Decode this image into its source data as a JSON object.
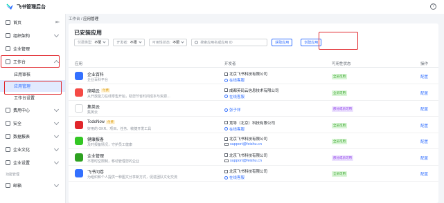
{
  "brand": {
    "name": "飞书管理后台",
    "help": "?"
  },
  "sidebar": {
    "collapse": "⇤",
    "items": [
      {
        "label": "首页"
      },
      {
        "label": "组织架构"
      },
      {
        "label": "企业管理"
      },
      {
        "label": "工作台"
      }
    ],
    "sub_items": [
      {
        "label": "应用审核"
      },
      {
        "label": "应用管理"
      },
      {
        "label": "工作台设置"
      }
    ],
    "items2": [
      {
        "label": "费用中心"
      },
      {
        "label": "安全"
      },
      {
        "label": "数据报表"
      },
      {
        "label": "企业文化"
      },
      {
        "label": "企业设置"
      }
    ],
    "group": "功能管理",
    "items3": [
      {
        "label": "邮箱"
      }
    ]
  },
  "breadcrumb": {
    "parent": "工作台",
    "sep": "/",
    "current": "应用管理"
  },
  "panel": {
    "title": "已安装应用",
    "filters": [
      {
        "label": "付费类型:",
        "value": "不限"
      },
      {
        "label": "开发者:",
        "value": "不限"
      },
      {
        "label": "可用性状态:",
        "value": "不限"
      }
    ],
    "search_placeholder": "搜索应用名或应用 ID",
    "get_app_btn": "获取应用",
    "create_app_btn": "创建应用",
    "columns": {
      "app": "应用",
      "developer": "开发者",
      "status": "可用性状态",
      "op": "操作"
    }
  },
  "apps": [
    {
      "name": "企业百科",
      "tag": "",
      "desc": "企业百科平台",
      "dev": "北京飞书科技有限公司",
      "contact": "在线客服",
      "status": "全员可用",
      "status_type": "all",
      "op": "配置",
      "color": "#3370ff"
    },
    {
      "name": "席喵云",
      "tag": "付费",
      "desc": "从开放能力在线零售开始，助您节省时间成本与资源…",
      "dev": "成都英码云信息技术有限公司",
      "contact": "在线客服",
      "status": "全员可用",
      "status_type": "all",
      "op": "配置",
      "color": "#f54a45"
    },
    {
      "name": "集英云",
      "tag": "",
      "desc": "集英云",
      "dev": "",
      "contact": "张子祥",
      "status": "部分成员可用",
      "status_type": "part",
      "op": "配置",
      "color": "#ffffff"
    },
    {
      "name": "TodoNow",
      "tag": "付费",
      "desc": "好用的 OKR、项目、任务、敏捷开发工具",
      "dev": "竞导（北京）科技有限公司",
      "contact": "在线客服",
      "status": "全员可用",
      "status_type": "all",
      "op": "配置",
      "color": "#e0262b"
    },
    {
      "name": "健康报备",
      "tag": "",
      "desc": "及时报备情况，守护员工健康",
      "dev": "北京飞书科技有限公司",
      "contact": "support@feishu.cn",
      "status": "全员可用",
      "status_type": "all",
      "op": "配置",
      "color": "#34c724"
    },
    {
      "name": "企业管理",
      "tag": "",
      "desc": "不限时空限制，移动管理您的企业",
      "dev": "北京飞书科技有限公司",
      "contact": "support@feishu.cn",
      "status": "部分成员可用",
      "status_type": "part",
      "op": "配置",
      "color": "#2ea121"
    },
    {
      "name": "飞书问卷",
      "tag": "",
      "desc": "为组织和个人提供一种图文分享新方式，促进团队文化交流",
      "dev": "北京飞书科技有限公司",
      "contact": "在线客服",
      "status": "全员可用",
      "status_type": "all",
      "op": "配置",
      "color": "#3370ff"
    }
  ]
}
